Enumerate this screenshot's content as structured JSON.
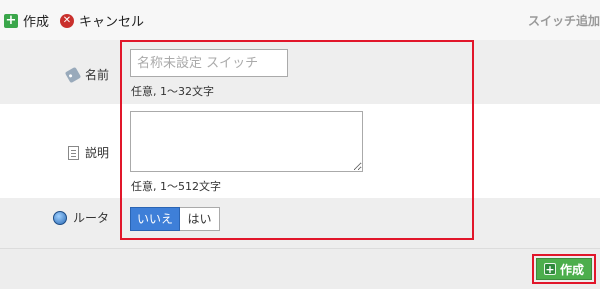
{
  "toolbar": {
    "create_label": "作成",
    "cancel_label": "キャンセル",
    "page_title": "スイッチ追加"
  },
  "form": {
    "name": {
      "label": "名前",
      "placeholder": "名称未設定 スイッチ",
      "value": "",
      "hint": "任意, 1〜32文字"
    },
    "description": {
      "label": "説明",
      "value": "",
      "hint": "任意, 1〜512文字"
    },
    "router": {
      "label": "ルータ",
      "options": [
        "いいえ",
        "はい"
      ],
      "selected": "いいえ"
    }
  },
  "footer": {
    "create_label": "作成"
  },
  "colors": {
    "accent": "#e1162a",
    "create_button": "#4cae4c",
    "toggle_selected": "#3e7fd8"
  }
}
